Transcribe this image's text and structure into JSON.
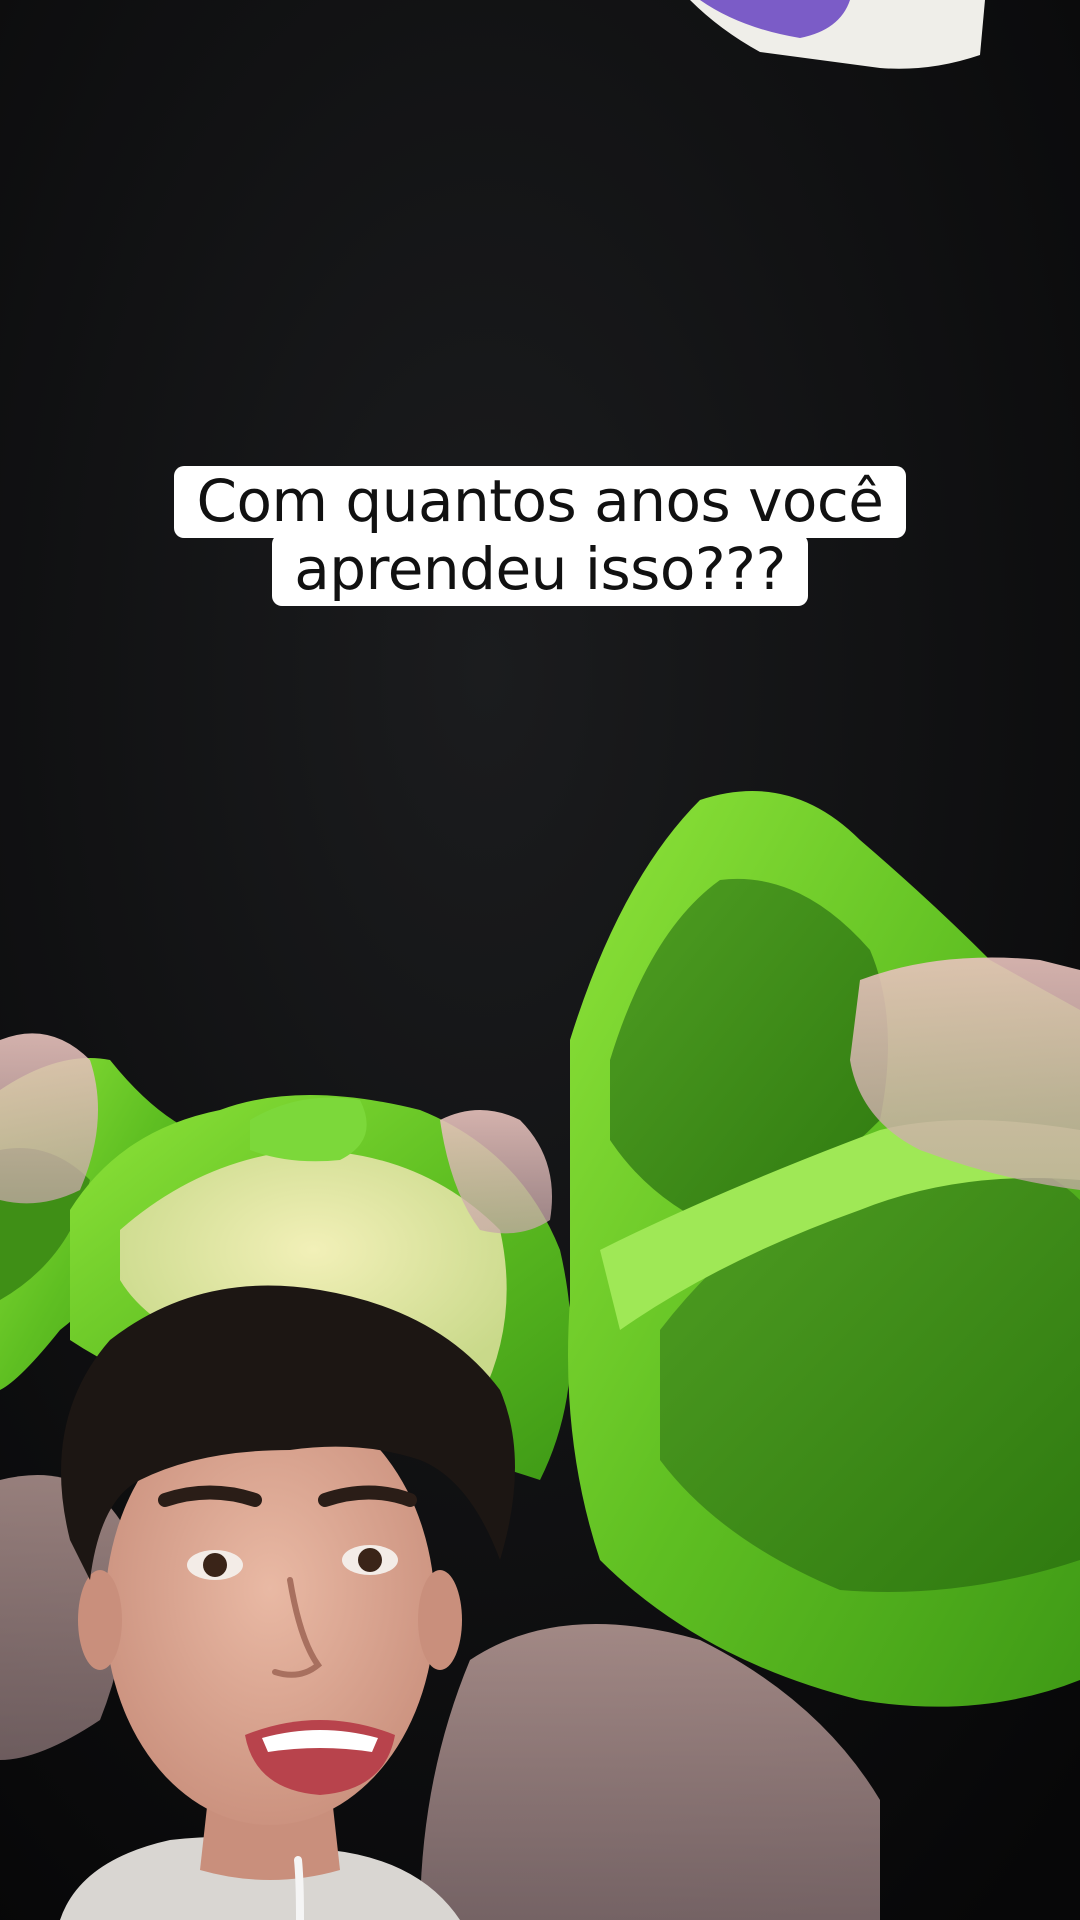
{
  "caption": {
    "line1": "Com quantos anos você",
    "line2": "aprendeu isso???"
  },
  "colors": {
    "background": "#0b0b0c",
    "pepper_green": "#6fcf2e",
    "caption_bg": "#ffffff",
    "caption_text": "#111111"
  }
}
